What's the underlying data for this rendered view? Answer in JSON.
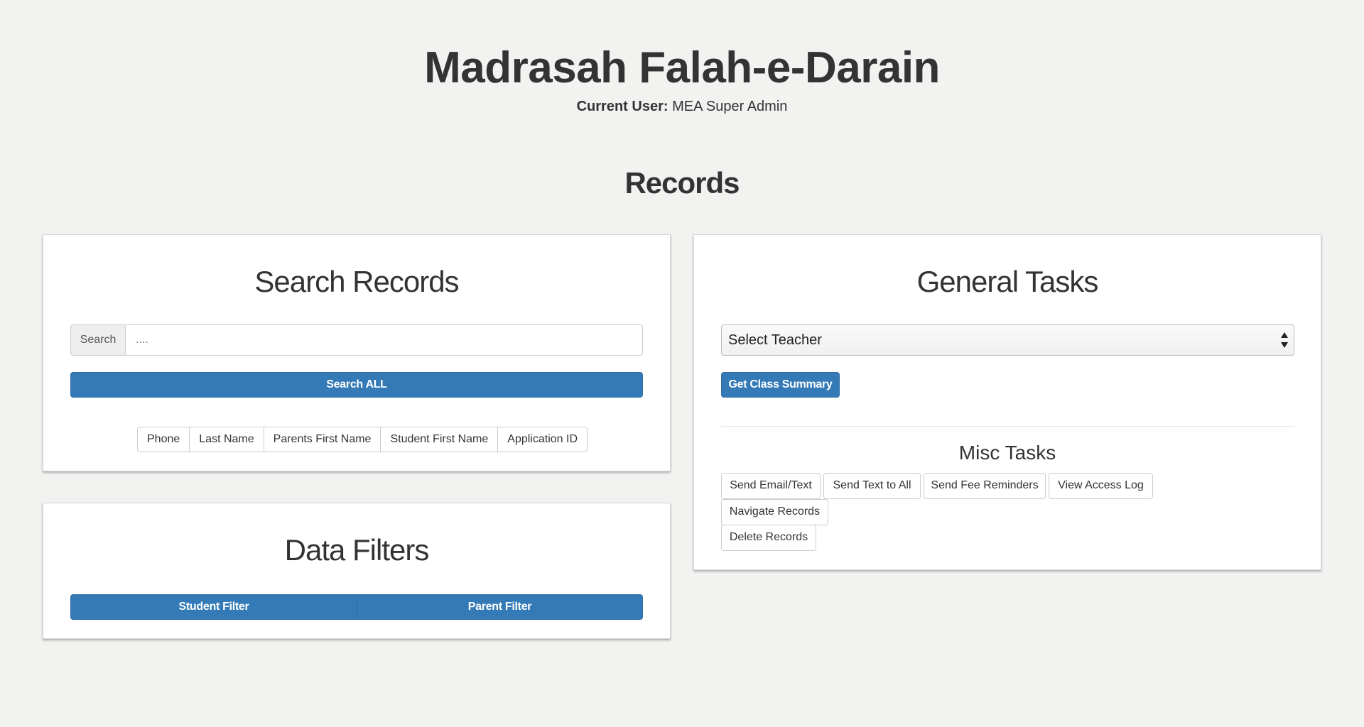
{
  "header": {
    "app_title": "Madrasah Falah-e-Darain",
    "current_user_label": "Current User:",
    "current_user_name": "MEA Super Admin"
  },
  "section_title": "Records",
  "search_panel": {
    "title": "Search Records",
    "search_addon": "Search",
    "search_placeholder": "....",
    "search_all_button": "Search ALL",
    "filters": [
      "Phone",
      "Last Name",
      "Parents First Name",
      "Student First Name",
      "Application ID"
    ]
  },
  "data_filters_panel": {
    "title": "Data Filters",
    "student_filter": "Student Filter",
    "parent_filter": "Parent Filter"
  },
  "general_tasks_panel": {
    "title": "General Tasks",
    "teacher_select_value": "Select Teacher",
    "class_summary_button": "Get Class Summary",
    "misc_title": "Misc Tasks",
    "misc_buttons": [
      "Send Email/Text",
      "Send Text to All",
      "Send Fee Reminders",
      "View Access Log",
      "Navigate Records",
      "Delete Records"
    ]
  },
  "colors": {
    "primary": "#337ab7",
    "background": "#f2f2f1"
  }
}
